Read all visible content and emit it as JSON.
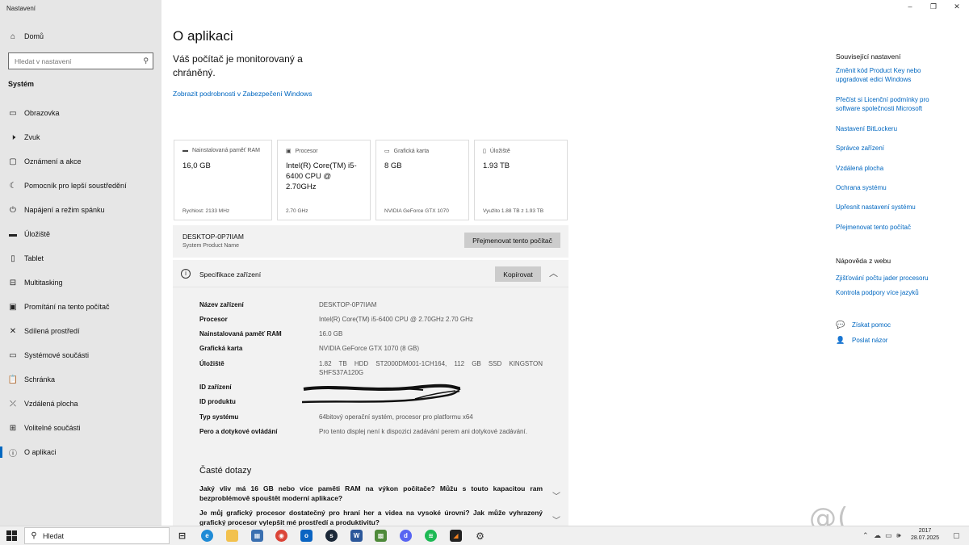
{
  "window": {
    "title": "Nastavení",
    "controls": {
      "minimize": "–",
      "maximize": "❐",
      "close": "✕"
    }
  },
  "sidebar": {
    "home_label": "Domů",
    "search_placeholder": "Hledat v nastavení",
    "section_title": "Systém",
    "items": [
      {
        "label": "Obrazovka",
        "icon": "monitor-icon"
      },
      {
        "label": "Zvuk",
        "icon": "speaker-icon"
      },
      {
        "label": "Oznámení a akce",
        "icon": "notification-icon"
      },
      {
        "label": "Pomocník pro lepší soustředění",
        "icon": "moon-icon"
      },
      {
        "label": "Napájení a režim spánku",
        "icon": "power-icon"
      },
      {
        "label": "Úložiště",
        "icon": "storage-icon"
      },
      {
        "label": "Tablet",
        "icon": "tablet-icon"
      },
      {
        "label": "Multitasking",
        "icon": "multitasking-icon"
      },
      {
        "label": "Promítání na tento počítač",
        "icon": "projecting-icon"
      },
      {
        "label": "Sdílená prostředí",
        "icon": "shared-icon"
      },
      {
        "label": "Systémové součásti",
        "icon": "components-icon"
      },
      {
        "label": "Schránka",
        "icon": "clipboard-icon"
      },
      {
        "label": "Vzdálená plocha",
        "icon": "remote-desktop-icon"
      },
      {
        "label": "Volitelné součásti",
        "icon": "optional-features-icon"
      },
      {
        "label": "O aplikaci",
        "icon": "info-icon",
        "active": true
      }
    ]
  },
  "main": {
    "title": "O aplikaci",
    "protection_text": "Váš počítač je monitorovaný a chráněný.",
    "security_link": "Zobrazit podrobnosti v Zabezpečení Windows",
    "cards": [
      {
        "caption": "Nainstalovaná paměť RAM",
        "value": "16,0 GB",
        "sub": "Rychlost: 2133 MHz",
        "icon": "ram-icon"
      },
      {
        "caption": "Procesor",
        "value": "Intel(R) Core(TM) i5-6400 CPU @ 2.70GHz",
        "sub": "2.70 GHz",
        "icon": "cpu-icon"
      },
      {
        "caption": "Grafická karta",
        "value": "8 GB",
        "sub": "NVIDIA GeForce GTX 1070",
        "icon": "gpu-icon"
      },
      {
        "caption": "Úložiště",
        "value": "1.93 TB",
        "sub": "Využito 1.88 TB z 1.93 TB",
        "icon": "storage-icon"
      }
    ],
    "device": {
      "name": "DESKTOP-0P7IIAM",
      "product_name": "System Product Name",
      "rename_button": "Přejmenovat tento počítač"
    },
    "specs": {
      "title": "Specifikace zařízení",
      "copy_button": "Kopírovat",
      "rows": [
        {
          "key": "Název zařízení",
          "value": "DESKTOP-0P7IIAM"
        },
        {
          "key": "Procesor",
          "value": "Intel(R) Core(TM) i5-6400 CPU @ 2.70GHz   2.70 GHz"
        },
        {
          "key": "Nainstalovaná paměť RAM",
          "value": "16.0 GB"
        },
        {
          "key": "Grafická karta",
          "value": "NVIDIA GeForce GTX 1070 (8 GB)"
        },
        {
          "key": "Úložiště",
          "value": "1.82 TB HDD ST2000DM001-1CH164, 112 GB SSD KINGSTON SHFS37A120G"
        },
        {
          "key": "ID zařízení",
          "value": ""
        },
        {
          "key": "ID produktu",
          "value": ""
        },
        {
          "key": "Typ systému",
          "value": "64bitový operační systém, procesor pro platformu x64"
        },
        {
          "key": "Pero a dotykové ovládání",
          "value": "Pro tento displej není k dispozici zadávání perem ani dotykové zadávání."
        }
      ]
    },
    "faq": {
      "title": "Časté dotazy",
      "questions": [
        "Jaký vliv má 16 GB nebo více paměti RAM na výkon počítače? Můžu s touto kapacitou ram bezproblémově spouštět moderní aplikace?",
        "Je můj grafický procesor dostatečný pro hraní her a videa na vysoké úrovni? Jak může vyhrazený grafický procesor vylepšit mé prostředí a produktivitu?"
      ]
    }
  },
  "right": {
    "related_title": "Související nastavení",
    "related_links": [
      "Změnit kód Product Key nebo upgradovat edici Windows",
      "Přečíst si Licenční podmínky pro software společnosti Microsoft",
      "Nastavení BitLockeru",
      "Správce zařízení",
      "Vzdálená plocha",
      "Ochrana systému",
      "Upřesnit nastavení systému",
      "Přejmenovat tento počítač"
    ],
    "web_help_title": "Nápověda z webu",
    "web_help_links": [
      "Zjišťování počtu jader procesoru",
      "Kontrola podpory více jazyků"
    ],
    "get_help": "Získat pomoc",
    "feedback": "Poslat názor"
  },
  "taskbar": {
    "search_label": "Hledat",
    "apps": [
      "task-view",
      "edge",
      "file-explorer",
      "store",
      "chrome",
      "outlook",
      "steam",
      "word",
      "minecraft",
      "minecraft-launcher",
      "discord",
      "spotify",
      "3dmark",
      "settings"
    ],
    "time": "2017",
    "date": "28.07.2025"
  },
  "watermark": "@( Bazos.cz"
}
